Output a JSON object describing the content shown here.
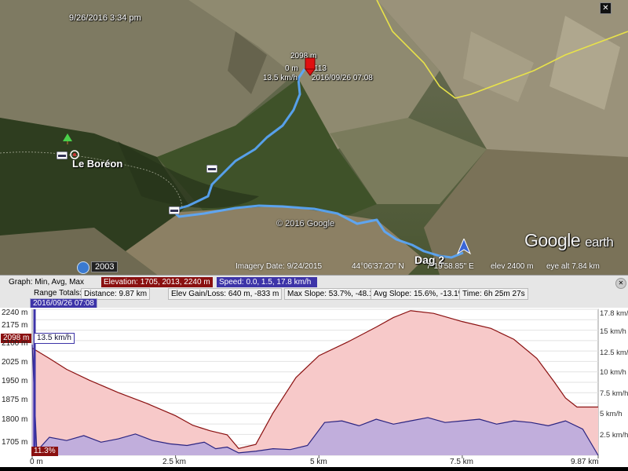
{
  "map": {
    "timestamp": "9/26/2016   3:34 pm",
    "place_label": "Le Boréon",
    "copyright": "© 2016 Google",
    "brand": "Google",
    "brand_suffix": "earth",
    "track_label": "Dag 2",
    "year_badge": "2003",
    "close_glyph": "✕",
    "cursor_popup": {
      "elevation": "2098 m",
      "line2_left": "0 m",
      "line2_right": "113",
      "speed": "13.5 km/h",
      "datetime": "2016/09/26 07:08"
    },
    "status": {
      "imagery_date": "Imagery Date: 9/24/2015",
      "lat": "44°06'37.20\" N",
      "lon": "7°19'58.85\" E",
      "elev": "elev  2400 m",
      "eye_alt": "eye alt   7.84 km"
    },
    "colors": {
      "track": "#5aa9ff",
      "border": "#e8e24a"
    },
    "icons": [
      "lodging-icon",
      "tree-icon",
      "navigation-arrow-icon",
      "cursor-pin-icon",
      "history-clock-icon"
    ]
  },
  "graph_header": {
    "graph_label": "Graph: Min, Avg, Max",
    "elevation_stat": "Elevation: 1705, 2013, 2240 m",
    "speed_stat": "Speed: 0.0, 1.5, 17.8 km/h",
    "range_label": "Range Totals:",
    "distance": "Distance: 9.87 km",
    "elev_gain": "Elev Gain/Loss: 640 m, -833 m",
    "max_slope": "Max Slope: 53.7%, -48.1%",
    "avg_slope": "Avg Slope: 15.6%, -13.1%",
    "time": "Time: 6h 25m 27s",
    "cursor_time": "2016/09/26 07:08"
  },
  "graph": {
    "elev_badge": "2098 m",
    "speed_badge": "13.5 km/h",
    "slope_badge": "11.3%",
    "left_ticks": [
      "2240 m",
      "2175 m",
      "2100 m",
      "2025 m",
      "1950 m",
      "1875 m",
      "1800 m",
      "1705 m"
    ],
    "right_ticks": [
      "17.8 km/h",
      "15 km/h",
      "12.5 km/h",
      "10 km/h",
      "7.5 km/h",
      "5 km/h",
      "2.5 km/h"
    ],
    "x_ticks": [
      "0 m",
      "2.5 km",
      "5 km",
      "7.5 km",
      "9.87 km"
    ]
  },
  "chart_data": {
    "type": "area",
    "x_unit": "km",
    "xlim": [
      0,
      9.87
    ],
    "series": [
      {
        "name": "Elevation",
        "unit": "m",
        "ylim": [
          1705,
          2240
        ],
        "color": "#8a1010",
        "fill": "#f7c9c9",
        "x": [
          0,
          0.3,
          0.6,
          1.0,
          1.5,
          2.0,
          2.5,
          2.8,
          3.1,
          3.4,
          3.6,
          3.9,
          4.2,
          4.6,
          5.0,
          5.5,
          6.0,
          6.3,
          6.6,
          7.0,
          7.5,
          8.0,
          8.4,
          8.8,
          9.1,
          9.3,
          9.5,
          9.87
        ],
        "values": [
          2098,
          2060,
          2020,
          1980,
          1935,
          1895,
          1850,
          1815,
          1795,
          1780,
          1730,
          1745,
          1860,
          1990,
          2070,
          2120,
          2175,
          2210,
          2235,
          2225,
          2195,
          2170,
          2130,
          2060,
          1975,
          1915,
          1882,
          1882
        ]
      },
      {
        "name": "Speed",
        "unit": "km/h",
        "ylim": [
          0,
          17.8
        ],
        "color": "#2a2380",
        "fill": "#b7a9df",
        "x": [
          0,
          0.08,
          0.3,
          0.6,
          0.9,
          1.2,
          1.5,
          1.8,
          2.1,
          2.4,
          2.7,
          3.0,
          3.2,
          3.4,
          3.6,
          3.9,
          4.2,
          4.5,
          4.8,
          5.1,
          5.4,
          5.7,
          6.0,
          6.3,
          6.6,
          6.9,
          7.2,
          7.5,
          7.8,
          8.1,
          8.4,
          8.7,
          9.0,
          9.3,
          9.6,
          9.87
        ],
        "values": [
          13.5,
          0.5,
          2.2,
          1.8,
          2.4,
          1.6,
          2.0,
          2.6,
          1.8,
          1.4,
          1.2,
          1.6,
          0.8,
          1.0,
          0.3,
          0.5,
          0.8,
          0.7,
          1.2,
          4.0,
          4.2,
          3.6,
          4.4,
          3.8,
          4.2,
          4.6,
          4.0,
          4.2,
          4.4,
          3.8,
          4.2,
          4.0,
          3.6,
          4.2,
          3.2,
          0.0
        ]
      }
    ],
    "grid": true
  }
}
